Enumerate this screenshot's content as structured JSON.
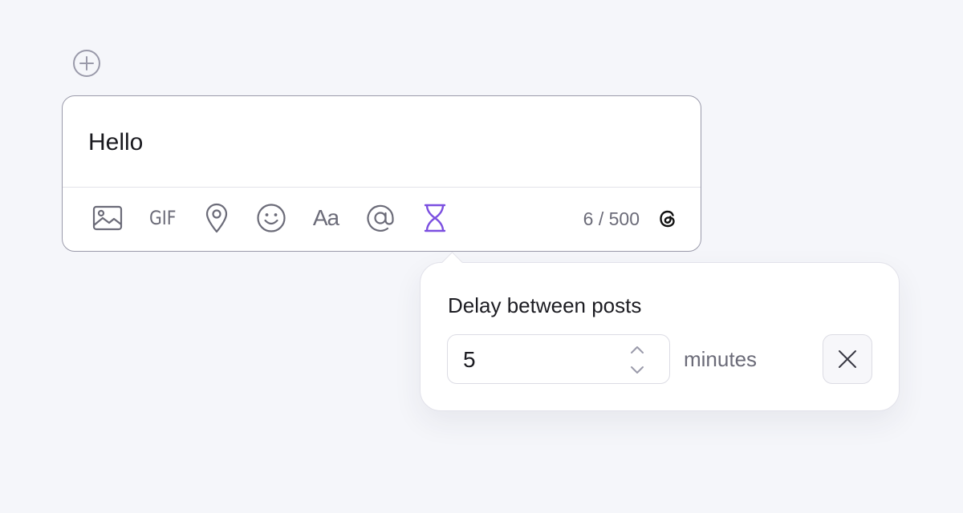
{
  "composer": {
    "text": "Hello",
    "toolbar": {
      "gif_label": "GIF",
      "font_label": "Aa"
    },
    "char_count": "6 / 500",
    "icons": {
      "add": "plus-circle-icon",
      "media": "image-icon",
      "gif": "gif-icon",
      "location": "location-pin-icon",
      "emoji": "smiley-icon",
      "font": "text-format-icon",
      "mention": "at-sign-icon",
      "delay": "hourglass-icon",
      "platform": "threads-icon"
    }
  },
  "delay_popover": {
    "title": "Delay between posts",
    "value": "5",
    "unit": "minutes",
    "close_icon": "close-icon"
  },
  "colors": {
    "background": "#f5f6fa",
    "accent": "#7b4fe0",
    "icon_gray": "#6b6b78",
    "border": "#9a9aaa"
  }
}
